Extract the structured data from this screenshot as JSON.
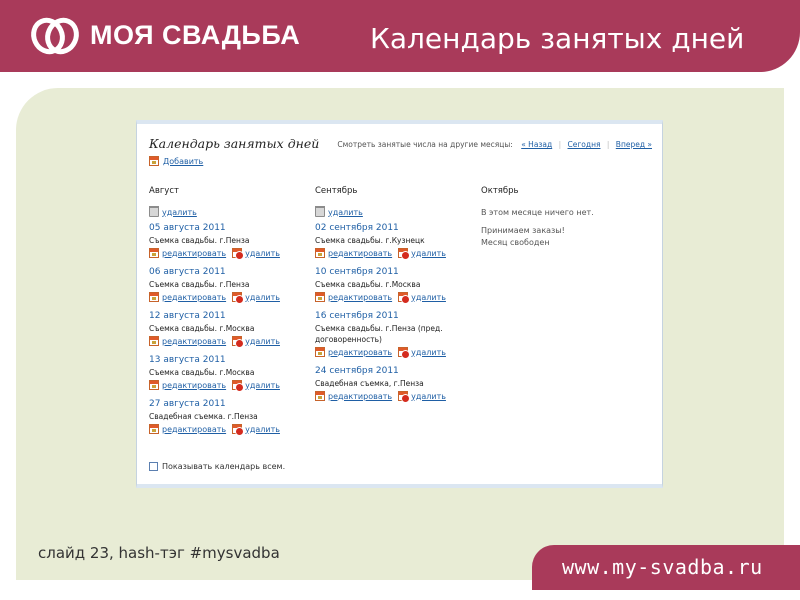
{
  "slide": {
    "brand": "МОЯ СВАДЬБА",
    "title": "Календарь занятых дней",
    "footer_caption": "слайд 23, hash-тэг #mysvadba",
    "footer_url": "www.my-svadba.ru",
    "colors": {
      "brand": "#a93a5a",
      "panel": "#e8ecd5"
    }
  },
  "calendar": {
    "title": "Календарь занятых дней",
    "add_label": "Добавить",
    "nav": {
      "prompt": "Смотреть занятые числа на другие месяцы:",
      "back": "« Назад",
      "today": "Сегодня",
      "forward": "Вперед »"
    },
    "months": [
      {
        "name": "Август",
        "delete_label": "удалить",
        "entries": [
          {
            "date": "05 августа 2011",
            "desc": "Съемка свадьбы. г.Пенза",
            "edit": "редактировать",
            "delete": "удалить"
          },
          {
            "date": "06 августа 2011",
            "desc": "Съемка свадьбы. г.Пенза",
            "edit": "редактировать",
            "delete": "удалить"
          },
          {
            "date": "12 августа 2011",
            "desc": "Съемка свадьбы. г.Москва",
            "edit": "редактировать",
            "delete": "удалить"
          },
          {
            "date": "13 августа 2011",
            "desc": "Съемка свадьбы. г.Москва",
            "edit": "редактировать",
            "delete": "удалить"
          },
          {
            "date": "27 августа 2011",
            "desc": "Свадебная съемка. г.Пенза",
            "edit": "редактировать",
            "delete": "удалить"
          }
        ]
      },
      {
        "name": "Сентябрь",
        "delete_label": "удалить",
        "entries": [
          {
            "date": "02 сентября 2011",
            "desc": "Съемка свадьбы. г.Кузнецк",
            "edit": "редактировать",
            "delete": "удалить"
          },
          {
            "date": "10 сентября 2011",
            "desc": "Съемка свадьбы. г.Москва",
            "edit": "редактировать",
            "delete": "удалить"
          },
          {
            "date": "16 сентября 2011",
            "desc": "Съемка свадьбы. г.Пенза (пред. договоренность)",
            "edit": "редактировать",
            "delete": "удалить"
          },
          {
            "date": "24 сентября 2011",
            "desc": "Свадебная съемка, г.Пенза",
            "edit": "редактировать",
            "delete": "удалить"
          }
        ]
      },
      {
        "name": "Октябрь",
        "empty_text": "В этом месяце ничего нет.",
        "note_line1": "Принимаем заказы!",
        "note_line2": "Месяц свободен"
      }
    ],
    "show_all_label": "Показывать календарь всем."
  }
}
